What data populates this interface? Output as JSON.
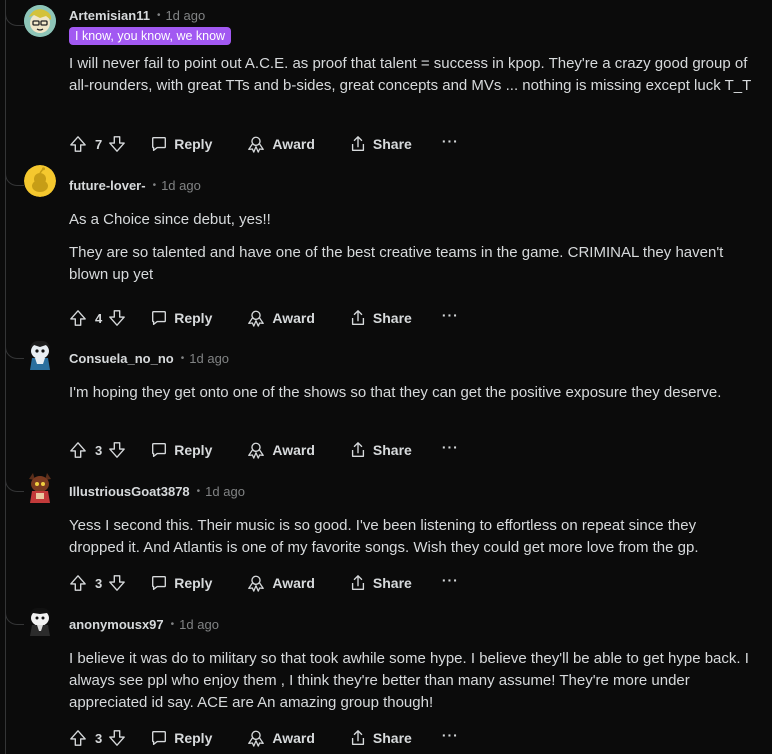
{
  "colors": {
    "background": "#0b0b0b",
    "text": "#d7dadc",
    "muted": "#818384",
    "flair_bg": "#a259f2",
    "thread_line": "#343536"
  },
  "actions": {
    "reply": "Reply",
    "award": "Award",
    "share": "Share",
    "more": "···"
  },
  "separator": "•",
  "comments": [
    {
      "username": "Artemisian11",
      "time": "1d ago",
      "flair": "I know, you know, we know",
      "paragraphs": [
        "I will never fail to point out A.C.E. as proof that talent = success in kpop. They're a crazy good group of all-rounders, with great TTs and b-sides, great concepts and MVs ... nothing is missing except luck T_T"
      ],
      "score": "7",
      "avatar": "cartoon-face-avatar"
    },
    {
      "username": "future-lover-",
      "time": "1d ago",
      "paragraphs": [
        "As a Choice since debut, yes!!",
        "They are so talented and have one of the best creative teams in the game. CRIMINAL they haven't blown up yet"
      ],
      "score": "4",
      "avatar": "snoo-default-avatar"
    },
    {
      "username": "Consuela_no_no",
      "time": "1d ago",
      "paragraphs": [
        "I'm hoping they get onto one of the shows so that they can get the positive exposure they deserve."
      ],
      "score": "3",
      "avatar": "snoo-character-avatar"
    },
    {
      "username": "IllustriousGoat3878",
      "time": "1d ago",
      "paragraphs": [
        "Yess I second this. Their music is so good. I've been listening to effortless on repeat since they dropped it. And Atlantis is one of my favorite songs. Wish they could get more love from the gp."
      ],
      "score": "3",
      "avatar": "snoo-character-avatar"
    },
    {
      "username": "anonymousx97",
      "time": "1d ago",
      "paragraphs": [
        "I believe it was do to military so that took awhile some hype. I believe they'll be able to get hype back. I always see ppl who enjoy them , I think they're better than many assume! They're more under appreciated id say. ACE are An amazing group though!"
      ],
      "score": "3",
      "avatar": "snoo-character-avatar"
    }
  ]
}
